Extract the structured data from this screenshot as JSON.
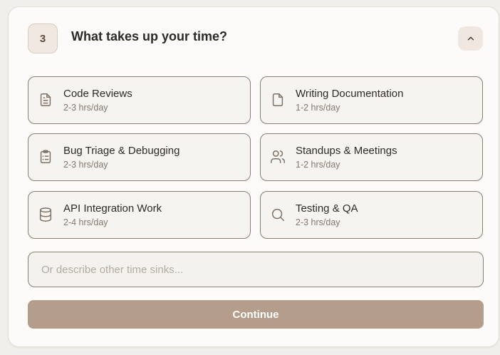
{
  "step": {
    "number": "3"
  },
  "question": {
    "title": "What takes up your time?"
  },
  "header": {
    "collapse_icon": "chevron-up-icon"
  },
  "options": [
    {
      "label": "Code Reviews",
      "time": "2-3 hrs/day",
      "icon": "file-text-icon"
    },
    {
      "label": "Writing Documentation",
      "time": "1-2 hrs/day",
      "icon": "file-icon"
    },
    {
      "label": "Bug Triage & Debugging",
      "time": "2-3 hrs/day",
      "icon": "clipboard-list-icon"
    },
    {
      "label": "Standups & Meetings",
      "time": "1-2 hrs/day",
      "icon": "users-icon"
    },
    {
      "label": "API Integration Work",
      "time": "2-4 hrs/day",
      "icon": "database-icon"
    },
    {
      "label": "Testing & QA",
      "time": "2-3 hrs/day",
      "icon": "search-icon"
    }
  ],
  "other": {
    "placeholder": "Or describe other time sinks...",
    "value": ""
  },
  "continue_button": {
    "label": "Continue"
  },
  "colors": {
    "accent": "#b49d8b",
    "border": "#8b7d70",
    "card_background": "#fcfbf9",
    "icon": "#7d7064"
  }
}
